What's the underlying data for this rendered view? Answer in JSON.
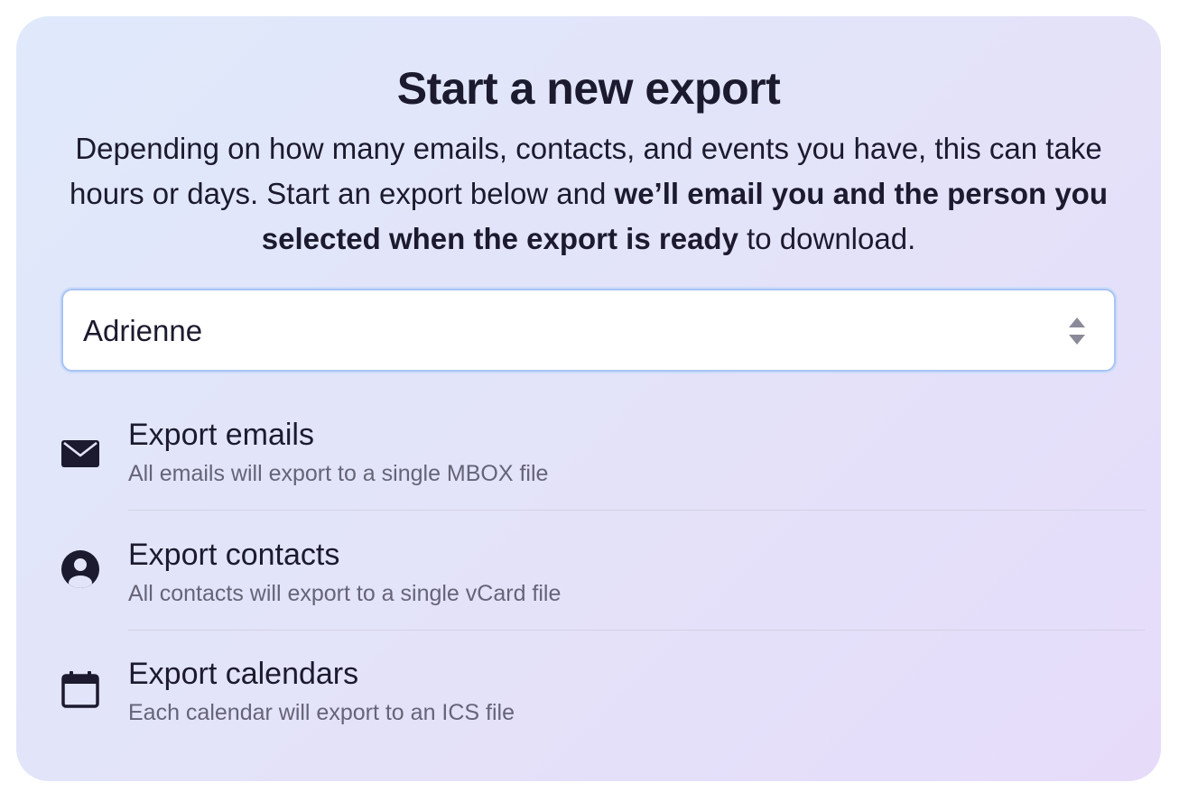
{
  "header": {
    "title": "Start a new export",
    "description_part1": "Depending on how many emails, contacts, and events you have, this can take hours or days. Start an export below and ",
    "description_bold": "we’ll email you and the person you selected when the export is ready",
    "description_part2": " to download."
  },
  "person_select": {
    "selected": "Adrienne"
  },
  "options": [
    {
      "title": "Export emails",
      "subtitle": "All emails will export to a single MBOX file",
      "icon": "envelope-icon"
    },
    {
      "title": "Export contacts",
      "subtitle": "All contacts will export to a single vCard file",
      "icon": "user-circle-icon"
    },
    {
      "title": "Export calendars",
      "subtitle": "Each calendar will export to an ICS file",
      "icon": "calendar-icon"
    }
  ],
  "colors": {
    "text": "#1c1a2e",
    "muted": "#656478",
    "focus_ring": "#a9c3f4"
  }
}
